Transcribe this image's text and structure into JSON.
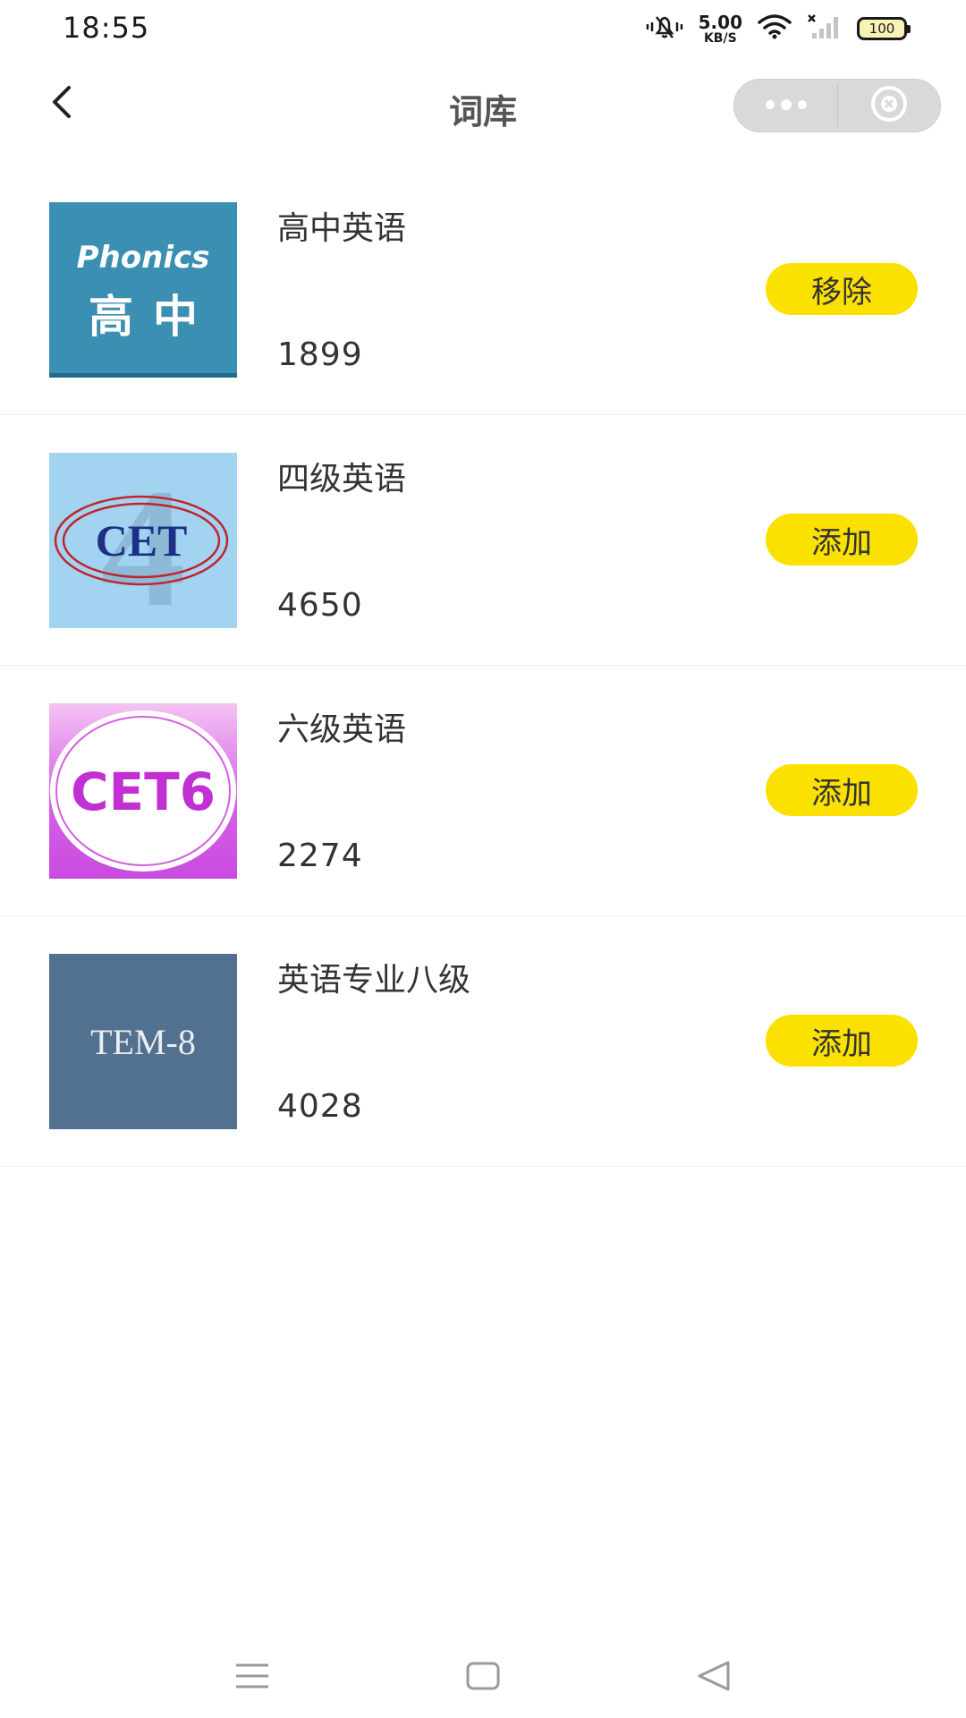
{
  "status_bar": {
    "time": "18:55",
    "speed_value": "5.00",
    "speed_unit": "KB/S",
    "battery": "100",
    "icons": [
      "mute-bell-icon",
      "wifi-icon",
      "signal-icon",
      "battery-icon"
    ]
  },
  "nav": {
    "title": "词库",
    "icons": [
      "back-chevron-icon",
      "more-dots-icon",
      "close-circle-icon"
    ]
  },
  "books": [
    {
      "cover": {
        "line1": "Phonics",
        "line2": "高中"
      },
      "name": "高中英语",
      "count": "1899",
      "action": "移除"
    },
    {
      "cover": {
        "text": "CET",
        "digit": "4"
      },
      "name": "四级英语",
      "count": "4650",
      "action": "添加"
    },
    {
      "cover": {
        "text": "CET6"
      },
      "name": "六级英语",
      "count": "2274",
      "action": "添加"
    },
    {
      "cover": {
        "text": "TEM-8"
      },
      "name": "英语专业八级",
      "count": "4028",
      "action": "添加"
    }
  ],
  "colors": {
    "accent": "#fbe100",
    "text": "#333333",
    "title": "#555555"
  },
  "system_nav": {
    "icons": [
      "menu-icon",
      "home-square-icon",
      "back-triangle-icon"
    ]
  }
}
